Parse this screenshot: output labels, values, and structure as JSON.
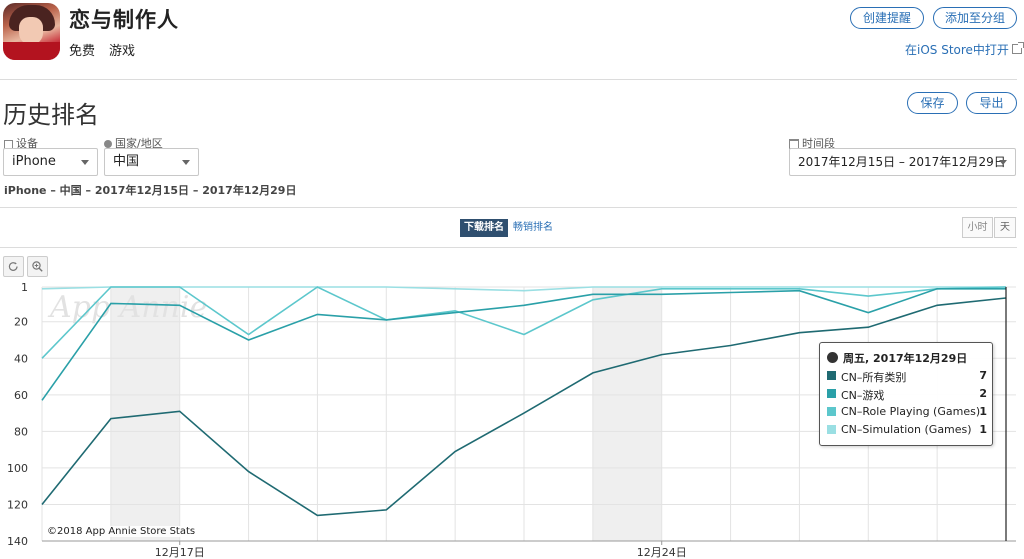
{
  "app": {
    "title": "恋与制作人",
    "price": "免费",
    "category": "游戏",
    "create_alert_label": "创建提醒",
    "add_to_group_label": "添加至分组",
    "open_in_store_label": "在iOS Store中打开"
  },
  "section": {
    "title": "历史排名",
    "save_label": "保存",
    "export_label": "导出"
  },
  "filters": {
    "device_label": "设备",
    "device_value": "iPhone",
    "country_label": "国家/地区",
    "country_value": "中国",
    "period_label": "时间段",
    "period_value": "2017年12月15日 – 2017年12月29日"
  },
  "subtitle": "iPhone – 中国 – 2017年12月15日 – 2017年12月29日",
  "tabs": {
    "download_rank": "下载排名",
    "grossing_rank": "畅销排名"
  },
  "granularity": {
    "hour": "小时",
    "day": "天"
  },
  "watermark": "App Annie",
  "copyright": "©2018 App Annie Store Stats",
  "tooltip": {
    "date": "周五, 2017年12月29日",
    "rows": [
      {
        "name": "CN–所有类别",
        "value": "7",
        "color": "#1f6a72"
      },
      {
        "name": "CN–游戏",
        "value": "2",
        "color": "#2aa0a8"
      },
      {
        "name": "CN–Role Playing (Games)",
        "value": "1",
        "color": "#5cc7cc"
      },
      {
        "name": "CN–Simulation (Games)",
        "value": "1",
        "color": "#9adfe3"
      }
    ]
  },
  "chart_data": {
    "type": "line",
    "x": [
      "12月15日",
      "12月16日",
      "12月17日",
      "12月18日",
      "12月19日",
      "12月20日",
      "12月21日",
      "12月22日",
      "12月23日",
      "12月24日",
      "12月25日",
      "12月26日",
      "12月27日",
      "12月28日",
      "12月29日"
    ],
    "x_tick_labels": [
      "12月17日",
      "12月24日"
    ],
    "x_tick_dates": [
      "12月17日",
      "12月24日"
    ],
    "weekend_shading": [
      [
        "12月16日",
        "12月17日"
      ],
      [
        "12月23日",
        "12月24日"
      ]
    ],
    "y_ticks": [
      1,
      20,
      40,
      60,
      80,
      100,
      120,
      140
    ],
    "y_reversed": true,
    "ylim": [
      1,
      140
    ],
    "grid": true,
    "series": [
      {
        "name": "CN–所有类别",
        "color": "#1f6a72",
        "values": [
          120,
          73,
          69,
          102,
          126,
          123,
          91,
          70,
          48,
          38,
          33,
          26,
          23,
          11,
          7
        ]
      },
      {
        "name": "CN–游戏",
        "color": "#2aa0a8",
        "values": [
          63,
          10,
          11,
          30,
          16,
          19,
          15,
          11,
          5,
          5,
          4,
          3,
          15,
          2,
          2
        ]
      },
      {
        "name": "CN–Role Playing (Games)",
        "color": "#5cc7cc",
        "values": [
          40,
          1,
          1,
          27,
          1,
          19,
          14,
          27,
          8,
          2,
          2,
          2,
          6,
          2,
          1
        ]
      },
      {
        "name": "CN–Simulation (Games)",
        "color": "#9adfe3",
        "values": [
          2,
          1,
          1,
          1,
          1,
          1,
          2,
          3,
          1,
          1,
          1,
          1,
          1,
          1,
          1
        ]
      }
    ],
    "highlight_x": "12月29日"
  }
}
